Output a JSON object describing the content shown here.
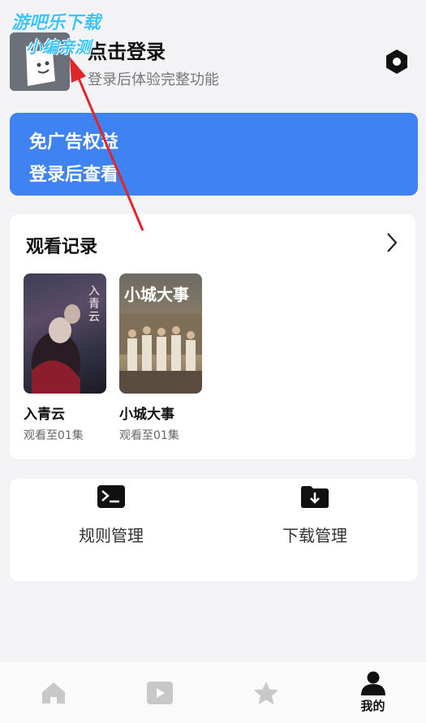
{
  "watermark": {
    "line1": "游吧乐下载",
    "line2": "小编亲测"
  },
  "header": {
    "title": "点击登录",
    "subtitle": "登录后体验完整功能"
  },
  "ad_card": {
    "line1": "免广告权益",
    "line2": "登录后查看"
  },
  "history": {
    "title": "观看记录",
    "items": [
      {
        "name": "入青云",
        "progress": "观看至01集",
        "poster_text": "入青云"
      },
      {
        "name": "小城大事",
        "progress": "观看至01集",
        "poster_text": "小城大事"
      }
    ]
  },
  "tools": [
    {
      "label": "规则管理",
      "icon": "terminal-icon"
    },
    {
      "label": "下载管理",
      "icon": "download-folder-icon"
    }
  ],
  "nav": {
    "items": [
      {
        "icon": "home-icon",
        "label": ""
      },
      {
        "icon": "video-icon",
        "label": ""
      },
      {
        "icon": "star-icon",
        "label": ""
      },
      {
        "icon": "user-icon",
        "label": "我的"
      }
    ],
    "active_color": "#111111",
    "inactive_color": "#c8c8c8"
  },
  "colors": {
    "accent": "#3f82f2",
    "annotation_arrow": "#e0262a"
  }
}
